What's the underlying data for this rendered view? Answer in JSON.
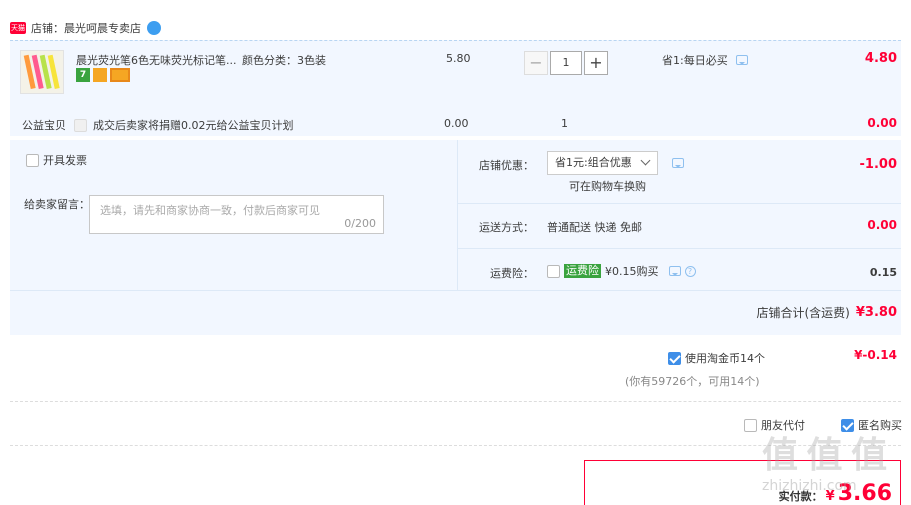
{
  "shop": {
    "label": "店铺：",
    "name": "晨光呵晨专卖店",
    "badge": "天猫"
  },
  "product": {
    "title": "晨光荧光笔6色无味荧光标记笔...",
    "attr_label": "颜色分类：",
    "attr_value": "3色装",
    "price": "5.80",
    "quantity": "1",
    "discount_label": "省1:每日必买",
    "subtotal": "4.80",
    "tag_seven": "7"
  },
  "charity": {
    "label": "公益宝贝",
    "desc": "成交后卖家将捐赠0.02元给公益宝贝计划",
    "price": "0.00",
    "qty": "1",
    "subtotal": "0.00"
  },
  "invoice": {
    "label": "开具发票"
  },
  "message": {
    "label": "给卖家留言：",
    "placeholder": "选填，请先和商家协商一致，付款后商家可见",
    "counter": "0/200"
  },
  "shop_discount": {
    "label": "店铺优惠：",
    "selected": "省1元:组合优惠",
    "hint": "可在购物车换购",
    "amount": "-1.00"
  },
  "shipping": {
    "label": "运送方式：",
    "value": "普通配送 快递 免邮",
    "amount": "0.00"
  },
  "insurance": {
    "label": "运费险：",
    "tag": "运费险",
    "desc": "¥0.15购买",
    "amount": "0.15"
  },
  "shop_total": {
    "label": "店铺合计(含运费)",
    "amount": "¥3.80"
  },
  "coins": {
    "label": "使用淘金币14个",
    "detail": "(你有59726个，可用14个)",
    "amount": "¥-0.14"
  },
  "options": {
    "friend_pay": "朋友代付",
    "anonymous": "匿名购买"
  },
  "payment": {
    "label": "实付款：",
    "currency": "¥",
    "amount": "3.66"
  },
  "watermark": "值 值 值",
  "watermark_url": "zhizhizhi.com"
}
